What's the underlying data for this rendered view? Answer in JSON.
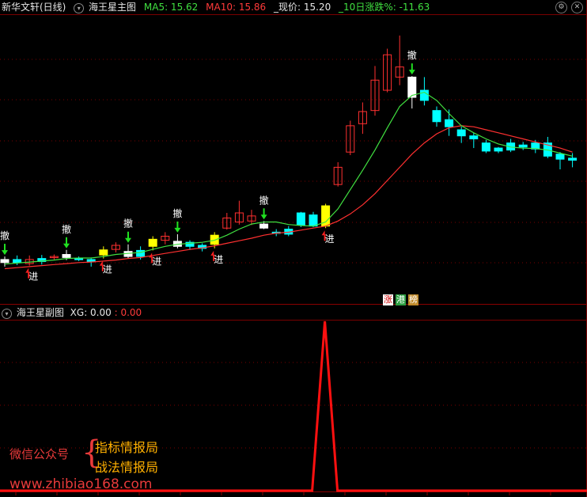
{
  "header": {
    "app_title": "新华文轩(日线)",
    "indicator_name": "海王星主图",
    "ma5_label": "MA5: 15.62",
    "ma10_label": "MA10: 15.86",
    "price_label": "_现价: 15.20",
    "change_label": "_10日涨跌%: -11.63"
  },
  "subpanel": {
    "indicator_name": "海王星副图",
    "xg_label": "XG: 0.00",
    "xg_value2": ": 0.00"
  },
  "badges": [
    "涨",
    "港",
    "榜"
  ],
  "watermark": {
    "account_label": "微信公众号",
    "line1": "指标情报局",
    "line2": "战法情报局",
    "url": "www.zhibiao168.com"
  },
  "signal_labels": {
    "withdraw": "撤",
    "enter": "进"
  },
  "colors": {
    "up": "#ff3030",
    "down": "#00ffff",
    "yellow": "#ffff00",
    "white": "#ffffff",
    "ma5": "#40e040",
    "ma10": "#ff3030",
    "grid": "#7a0000"
  },
  "chart_data": {
    "type": "candlestick",
    "y_range": [
      12.5,
      18.2
    ],
    "candles": [
      {
        "o": 13.3,
        "c": 13.36,
        "h": 13.42,
        "l": 13.22,
        "t": "white"
      },
      {
        "o": 13.36,
        "c": 13.3,
        "h": 13.44,
        "l": 13.25,
        "t": "down"
      },
      {
        "o": 13.28,
        "c": 13.36,
        "h": 13.44,
        "l": 13.24,
        "t": "up"
      },
      {
        "o": 13.38,
        "c": 13.32,
        "h": 13.45,
        "l": 13.26,
        "t": "down"
      },
      {
        "o": 13.4,
        "c": 13.42,
        "h": 13.46,
        "l": 13.36,
        "t": "up"
      },
      {
        "o": 13.4,
        "c": 13.46,
        "h": 13.55,
        "l": 13.35,
        "t": "white"
      },
      {
        "o": 13.38,
        "c": 13.36,
        "h": 13.42,
        "l": 13.33,
        "t": "down"
      },
      {
        "o": 13.36,
        "c": 13.32,
        "h": 13.4,
        "l": 13.22,
        "t": "down"
      },
      {
        "o": 13.45,
        "c": 13.55,
        "h": 13.62,
        "l": 13.38,
        "t": "yellow"
      },
      {
        "o": 13.56,
        "c": 13.64,
        "h": 13.7,
        "l": 13.5,
        "t": "up"
      },
      {
        "o": 13.42,
        "c": 13.52,
        "h": 13.66,
        "l": 13.38,
        "t": "white"
      },
      {
        "o": 13.54,
        "c": 13.42,
        "h": 13.62,
        "l": 13.36,
        "t": "down"
      },
      {
        "o": 13.62,
        "c": 13.76,
        "h": 13.82,
        "l": 13.54,
        "t": "yellow"
      },
      {
        "o": 13.74,
        "c": 13.82,
        "h": 13.9,
        "l": 13.66,
        "t": "up"
      },
      {
        "o": 13.62,
        "c": 13.72,
        "h": 13.86,
        "l": 13.58,
        "t": "white"
      },
      {
        "o": 13.7,
        "c": 13.62,
        "h": 13.74,
        "l": 13.55,
        "t": "down"
      },
      {
        "o": 13.64,
        "c": 13.58,
        "h": 13.68,
        "l": 13.52,
        "t": "down"
      },
      {
        "o": 13.66,
        "c": 13.84,
        "h": 13.9,
        "l": 13.58,
        "t": "yellow"
      },
      {
        "o": 13.98,
        "c": 14.18,
        "h": 14.28,
        "l": 13.95,
        "t": "up"
      },
      {
        "o": 14.1,
        "c": 14.28,
        "h": 14.52,
        "l": 14.05,
        "t": "up"
      },
      {
        "o": 14.12,
        "c": 14.22,
        "h": 14.34,
        "l": 14.04,
        "t": "up"
      },
      {
        "o": 14.06,
        "c": 13.98,
        "h": 14.12,
        "l": 13.96,
        "t": "white"
      },
      {
        "o": 13.9,
        "c": 13.88,
        "h": 13.96,
        "l": 13.82,
        "t": "down"
      },
      {
        "o": 13.96,
        "c": 13.86,
        "h": 14.02,
        "l": 13.82,
        "t": "down"
      },
      {
        "o": 14.04,
        "c": 14.28,
        "h": 14.3,
        "l": 14.0,
        "t": "down"
      },
      {
        "o": 14.24,
        "c": 14.02,
        "h": 14.3,
        "l": 14.0,
        "t": "down"
      },
      {
        "o": 14.02,
        "c": 14.42,
        "h": 14.46,
        "l": 13.98,
        "t": "yellow"
      },
      {
        "o": 14.84,
        "c": 15.18,
        "h": 15.28,
        "l": 14.8,
        "t": "up"
      },
      {
        "o": 15.48,
        "c": 16.0,
        "h": 16.1,
        "l": 15.42,
        "t": "up"
      },
      {
        "o": 16.04,
        "c": 16.28,
        "h": 16.46,
        "l": 15.84,
        "t": "up"
      },
      {
        "o": 16.3,
        "c": 16.9,
        "h": 17.18,
        "l": 16.2,
        "t": "up"
      },
      {
        "o": 16.7,
        "c": 17.4,
        "h": 17.52,
        "l": 16.66,
        "t": "up"
      },
      {
        "o": 16.96,
        "c": 17.16,
        "h": 17.78,
        "l": 16.8,
        "t": "up"
      },
      {
        "o": 16.56,
        "c": 16.96,
        "h": 16.98,
        "l": 16.34,
        "t": "white"
      },
      {
        "o": 16.7,
        "c": 16.5,
        "h": 16.96,
        "l": 16.4,
        "t": "down"
      },
      {
        "o": 16.3,
        "c": 16.08,
        "h": 16.38,
        "l": 15.98,
        "t": "down"
      },
      {
        "o": 16.12,
        "c": 15.98,
        "h": 16.32,
        "l": 15.8,
        "t": "down"
      },
      {
        "o": 15.92,
        "c": 15.8,
        "h": 15.98,
        "l": 15.66,
        "t": "down"
      },
      {
        "o": 15.8,
        "c": 15.74,
        "h": 15.86,
        "l": 15.56,
        "t": "down"
      },
      {
        "o": 15.66,
        "c": 15.5,
        "h": 15.72,
        "l": 15.46,
        "t": "down"
      },
      {
        "o": 15.56,
        "c": 15.5,
        "h": 15.58,
        "l": 15.46,
        "t": "down"
      },
      {
        "o": 15.66,
        "c": 15.52,
        "h": 15.74,
        "l": 15.48,
        "t": "down"
      },
      {
        "o": 15.62,
        "c": 15.58,
        "h": 15.68,
        "l": 15.52,
        "t": "down"
      },
      {
        "o": 15.66,
        "c": 15.54,
        "h": 15.72,
        "l": 15.46,
        "t": "down"
      },
      {
        "o": 15.66,
        "c": 15.4,
        "h": 15.78,
        "l": 15.36,
        "t": "down"
      },
      {
        "o": 15.44,
        "c": 15.34,
        "h": 15.48,
        "l": 15.14,
        "t": "down"
      },
      {
        "o": 15.36,
        "c": 15.32,
        "h": 15.46,
        "l": 15.18,
        "t": "down"
      }
    ],
    "ma5": [
      13.27,
      13.29,
      13.31,
      13.33,
      13.35,
      13.38,
      13.39,
      13.39,
      13.42,
      13.46,
      13.48,
      13.5,
      13.56,
      13.62,
      13.66,
      13.68,
      13.7,
      13.74,
      13.84,
      13.96,
      14.06,
      14.1,
      14.1,
      14.05,
      14.03,
      14.02,
      14.1,
      14.36,
      14.74,
      15.12,
      15.52,
      15.96,
      16.38,
      16.6,
      16.66,
      16.5,
      16.24,
      16.0,
      15.86,
      15.74,
      15.64,
      15.58,
      15.56,
      15.55,
      15.52,
      15.46,
      15.4
    ],
    "ma10": [
      13.18,
      13.2,
      13.22,
      13.24,
      13.26,
      13.28,
      13.3,
      13.31,
      13.33,
      13.35,
      13.38,
      13.4,
      13.44,
      13.48,
      13.52,
      13.56,
      13.59,
      13.63,
      13.68,
      13.73,
      13.78,
      13.84,
      13.88,
      13.9,
      13.94,
      13.98,
      14.02,
      14.12,
      14.26,
      14.44,
      14.66,
      14.92,
      15.18,
      15.44,
      15.66,
      15.84,
      15.96,
      16.0,
      15.98,
      15.92,
      15.86,
      15.8,
      15.74,
      15.68,
      15.62,
      15.56,
      15.48
    ],
    "withdraw_signals": [
      0,
      5,
      10,
      14,
      21,
      33
    ],
    "enter_signals": [
      2,
      8,
      12,
      17,
      26
    ],
    "xg_indicator": {
      "spike_index": 26,
      "value": 1
    }
  }
}
